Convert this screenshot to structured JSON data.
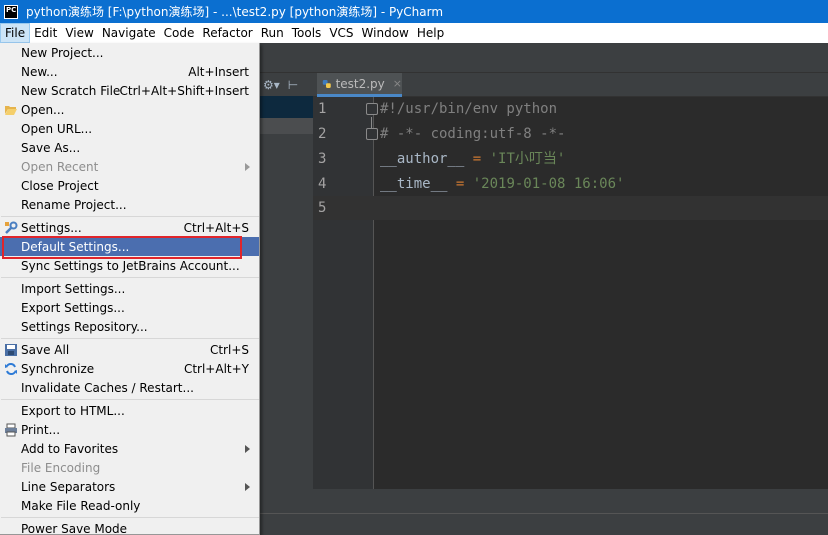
{
  "window": {
    "title": "python演练场 [F:\\python演练场] - ...\\test2.py [python演练场] - PyCharm",
    "app_icon": "PC"
  },
  "menubar": [
    {
      "label": "File",
      "active": true
    },
    {
      "label": "Edit"
    },
    {
      "label": "View"
    },
    {
      "label": "Navigate"
    },
    {
      "label": "Code"
    },
    {
      "label": "Refactor"
    },
    {
      "label": "Run"
    },
    {
      "label": "Tools"
    },
    {
      "label": "VCS"
    },
    {
      "label": "Window"
    },
    {
      "label": "Help"
    }
  ],
  "file_menu": {
    "items": [
      {
        "label": "New Project...",
        "shortcut": ""
      },
      {
        "label": "New...",
        "shortcut": "Alt+Insert"
      },
      {
        "label": "New Scratch File",
        "shortcut": "Ctrl+Alt+Shift+Insert"
      },
      {
        "label": "Open...",
        "shortcut": "",
        "icon": "folder-open-icon"
      },
      {
        "label": "Open URL...",
        "shortcut": ""
      },
      {
        "label": "Save As...",
        "shortcut": ""
      },
      {
        "label": "Open Recent",
        "shortcut": "",
        "disabled": true,
        "submenu": true
      },
      {
        "label": "Close Project",
        "shortcut": ""
      },
      {
        "label": "Rename Project...",
        "shortcut": ""
      },
      {
        "label": "Settings...",
        "shortcut": "Ctrl+Alt+S",
        "icon": "wrench-icon"
      },
      {
        "label": "Default Settings...",
        "shortcut": "",
        "highlighted": true
      },
      {
        "label": "Sync Settings to JetBrains Account...",
        "shortcut": ""
      },
      {
        "label": "Import Settings...",
        "shortcut": ""
      },
      {
        "label": "Export Settings...",
        "shortcut": ""
      },
      {
        "label": "Settings Repository...",
        "shortcut": ""
      },
      {
        "label": "Save All",
        "shortcut": "Ctrl+S",
        "icon": "save-icon"
      },
      {
        "label": "Synchronize",
        "shortcut": "Ctrl+Alt+Y",
        "icon": "sync-icon"
      },
      {
        "label": "Invalidate Caches / Restart...",
        "shortcut": ""
      },
      {
        "label": "Export to HTML...",
        "shortcut": ""
      },
      {
        "label": "Print...",
        "shortcut": "",
        "icon": "print-icon"
      },
      {
        "label": "Add to Favorites",
        "shortcut": "",
        "submenu": true
      },
      {
        "label": "File Encoding",
        "shortcut": "",
        "disabled": true
      },
      {
        "label": "Line Separators",
        "shortcut": "",
        "submenu": true
      },
      {
        "label": "Make File Read-only",
        "shortcut": ""
      },
      {
        "label": "Power Save Mode",
        "shortcut": ""
      }
    ]
  },
  "editor": {
    "tab_label": "test2.py",
    "line_numbers": [
      "1",
      "2",
      "3",
      "4",
      "5"
    ],
    "lines": [
      {
        "parts": [
          {
            "t": "#!/usr/bin/env python",
            "c": "comment"
          }
        ]
      },
      {
        "parts": [
          {
            "t": "# -*- coding:utf-8 -*-",
            "c": "comment"
          }
        ]
      },
      {
        "parts": [
          {
            "t": "__author__",
            "c": "ident"
          },
          {
            "t": " = ",
            "c": "op"
          },
          {
            "t": "'IT小叮当'",
            "c": "str"
          }
        ]
      },
      {
        "parts": [
          {
            "t": "__time__",
            "c": "ident"
          },
          {
            "t": " = ",
            "c": "op"
          },
          {
            "t": "'2019-01-08 16:06'",
            "c": "str"
          }
        ]
      },
      {
        "parts": []
      }
    ]
  },
  "colors": {
    "title_bar": "#0b6fd0",
    "highlight": "#4b6eaf",
    "red_annotation": "#e0252b"
  }
}
